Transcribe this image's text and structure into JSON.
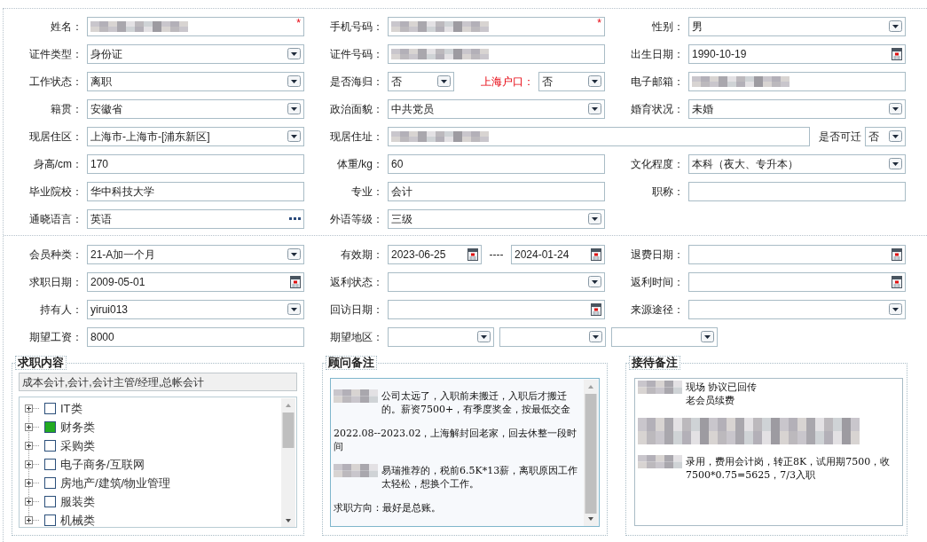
{
  "profile": {
    "rows": [
      {
        "fields": [
          {
            "label": "姓名：",
            "inputs": [
              {
                "kind": "text",
                "blurred": true,
                "mark": "*"
              }
            ]
          },
          {
            "label": "手机号码：",
            "inputs": [
              {
                "kind": "text",
                "blurred": true,
                "mark": "*"
              }
            ]
          },
          {
            "label": "性别：",
            "inputs": [
              {
                "kind": "select",
                "value": "男"
              }
            ]
          }
        ]
      },
      {
        "fields": [
          {
            "label": "证件类型：",
            "inputs": [
              {
                "kind": "select",
                "value": "身份证"
              }
            ]
          },
          {
            "label": "证件号码：",
            "inputs": [
              {
                "kind": "text",
                "blurred": true
              }
            ]
          },
          {
            "label": "出生日期：",
            "inputs": [
              {
                "kind": "date",
                "value": "1990-10-19"
              }
            ]
          }
        ]
      },
      {
        "fields": [
          {
            "label": "工作状态：",
            "inputs": [
              {
                "kind": "select",
                "value": "离职"
              }
            ]
          },
          {
            "label": "是否海归：",
            "inputs": [
              {
                "kind": "select",
                "value": "否"
              }
            ],
            "extra": {
              "label": "上海户口：",
              "highlight": true,
              "inputs": [
                {
                  "kind": "select",
                  "value": "否"
                }
              ]
            }
          },
          {
            "label": "电子邮箱：",
            "inputs": [
              {
                "kind": "text",
                "blurred": true
              }
            ]
          }
        ]
      },
      {
        "fields": [
          {
            "label": "籍贯：",
            "inputs": [
              {
                "kind": "select",
                "value": "安徽省"
              }
            ]
          },
          {
            "label": "政治面貌：",
            "inputs": [
              {
                "kind": "select",
                "value": "中共党员"
              }
            ]
          },
          {
            "label": "婚育状况：",
            "inputs": [
              {
                "kind": "select",
                "value": "未婚"
              }
            ]
          }
        ]
      },
      {
        "fields": [
          {
            "label": "现居住区：",
            "inputs": [
              {
                "kind": "select",
                "value": "上海市-上海市-[浦东新区]"
              }
            ]
          },
          {
            "label": "现居住址：",
            "inputs": [
              {
                "kind": "text",
                "blurred": true
              }
            ],
            "extra": {
              "label": "是否可迁",
              "highlight": false,
              "inputs": [
                {
                  "kind": "select",
                  "value": "否"
                }
              ]
            }
          }
        ]
      },
      {
        "fields": [
          {
            "label": "身高/cm：",
            "inputs": [
              {
                "kind": "text",
                "value": "170"
              }
            ]
          },
          {
            "label": "体重/kg：",
            "inputs": [
              {
                "kind": "text",
                "value": "60"
              }
            ]
          },
          {
            "label": "文化程度：",
            "inputs": [
              {
                "kind": "select",
                "value": "本科（夜大、专升本）"
              }
            ]
          }
        ]
      },
      {
        "fields": [
          {
            "label": "毕业院校：",
            "inputs": [
              {
                "kind": "text",
                "value": "华中科技大学"
              }
            ]
          },
          {
            "label": "专业：",
            "inputs": [
              {
                "kind": "text",
                "value": "会计"
              }
            ]
          },
          {
            "label": "职称：",
            "inputs": [
              {
                "kind": "text"
              }
            ]
          }
        ]
      },
      {
        "fields": [
          {
            "label": "通晓语言：",
            "inputs": [
              {
                "kind": "lookup",
                "value": "英语"
              }
            ]
          },
          {
            "label": "外语等级：",
            "inputs": [
              {
                "kind": "select",
                "value": "三级"
              }
            ]
          }
        ]
      }
    ]
  },
  "membership": {
    "rows": [
      {
        "fields": [
          {
            "label": "会员种类：",
            "inputs": [
              {
                "kind": "select",
                "value": "21-A加一个月"
              }
            ]
          },
          {
            "label": "有效期：",
            "inputs": [
              {
                "kind": "date",
                "value": "2023-06-25"
              },
              {
                "kind": "date",
                "value": "2024-01-24"
              }
            ],
            "separator": "----"
          },
          {
            "label": "退费日期：",
            "inputs": [
              {
                "kind": "date"
              }
            ]
          }
        ]
      },
      {
        "fields": [
          {
            "label": "求职日期：",
            "inputs": [
              {
                "kind": "date",
                "value": "2009-05-01"
              }
            ]
          },
          {
            "label": "返利状态：",
            "inputs": [
              {
                "kind": "select"
              }
            ]
          },
          {
            "label": "返利时间：",
            "inputs": [
              {
                "kind": "date"
              }
            ]
          }
        ]
      },
      {
        "fields": [
          {
            "label": "持有人：",
            "inputs": [
              {
                "kind": "select",
                "value": "yirui013"
              }
            ]
          },
          {
            "label": "回访日期：",
            "inputs": [
              {
                "kind": "date"
              }
            ]
          },
          {
            "label": "来源途径：",
            "inputs": [
              {
                "kind": "select"
              }
            ]
          }
        ]
      },
      {
        "fields": [
          {
            "label": "期望工资：",
            "inputs": [
              {
                "kind": "text",
                "value": "8000"
              }
            ]
          },
          {
            "label": "期望地区：",
            "inputs": [
              {
                "kind": "select"
              },
              {
                "kind": "select"
              },
              {
                "kind": "select"
              }
            ]
          }
        ]
      }
    ]
  },
  "job_intent": {
    "legend": "求职内容",
    "selection": "成本会计,会计,会计主管/经理,总帐会计",
    "tree": [
      {
        "label": "IT类",
        "checked": false
      },
      {
        "label": "财务类",
        "checked": true
      },
      {
        "label": "采购类",
        "checked": false
      },
      {
        "label": "电子商务/互联网",
        "checked": false
      },
      {
        "label": "房地产/建筑/物业管理",
        "checked": false
      },
      {
        "label": "服装类",
        "checked": false
      },
      {
        "label": "机械类",
        "checked": false
      }
    ]
  },
  "advisor_notes": {
    "legend": "顾问备注",
    "paragraphs": [
      {
        "blurred_lead": true,
        "lines": [
          "公司太远了，入职前未搬迁，入职后才搬迁的。薪资7500+，有季度奖金，按最低交金"
        ]
      },
      {
        "blurred_lead": false,
        "lines": [
          "2022.08--2023.02，上海解封回老家，回去休整一段时间"
        ]
      },
      {
        "blurred_lead": true,
        "lines": [
          "易瑞推荐的，税前6.5K*13薪，离职原因工作太轻松，想换个工作。"
        ]
      },
      {
        "blurred_lead": false,
        "lines": [
          "求职方向：最好是总账。"
        ]
      }
    ]
  },
  "reception_notes": {
    "legend": "接待备注",
    "paragraphs": [
      {
        "blurred_lead": true,
        "lines": [
          "现场 协议已回传",
          "老会员续费"
        ]
      },
      {
        "blurred_lead": true
      },
      {
        "blurred_lead": true,
        "lines": [
          "录用，费用会计岗，转正8K，试用期7500，收7500*0.75=5625，7/3入职"
        ]
      }
    ]
  }
}
